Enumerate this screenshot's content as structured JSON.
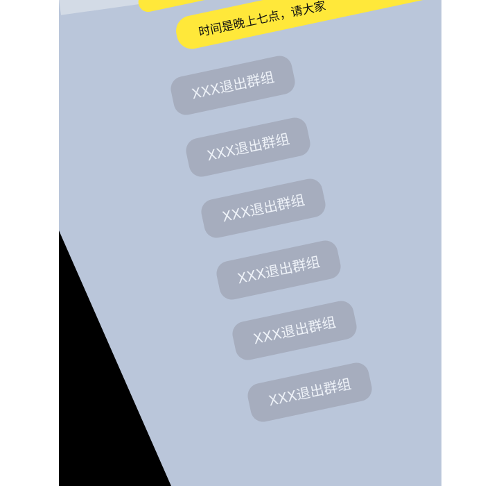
{
  "chat": {
    "message_main": "时间是晚上七点，请大家",
    "system_notices": [
      "XXX退出群组",
      "XXX退出群组",
      "XXX退出群组",
      "XXX退出群组",
      "XXX退出群组",
      "XXX退出群组"
    ]
  },
  "colors": {
    "screen_bg": "#bac6da",
    "message_bubble": "#ffe83a",
    "system_notice_bg": "#a6adbe",
    "system_notice_text": "#eef2f8"
  }
}
